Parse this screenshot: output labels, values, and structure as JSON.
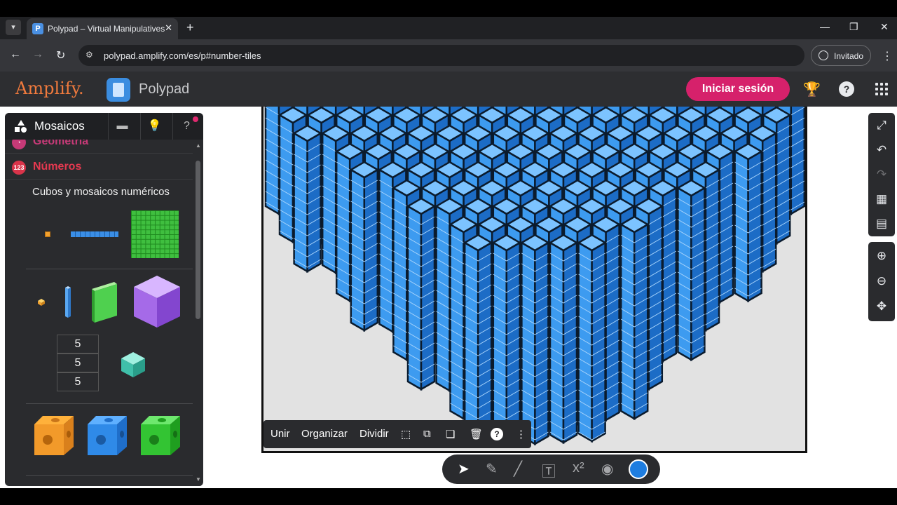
{
  "browser": {
    "tab_title": "Polypad – Virtual Manipulatives",
    "favicon_letter": "P",
    "url": "polypad.amplify.com/es/p#number-tiles",
    "guest_label": "Invitado"
  },
  "app": {
    "brand": "Amplify.",
    "product": "Polypad",
    "signin_label": "Iniciar sesión"
  },
  "sidebar": {
    "title": "Mosaicos",
    "category_above": "Geometría",
    "category": "Números",
    "category_badge": "123",
    "subcategory": "Cubos y mosaicos numéricos",
    "number_tiles": [
      "5",
      "5",
      "5"
    ]
  },
  "actionbar": {
    "join": "Unir",
    "organize": "Organizar",
    "split": "Dividir"
  },
  "colors": {
    "accent_pink": "#d6216b",
    "cube_blue": "#2f8ae0",
    "brand_orange": "#f07a3d"
  }
}
